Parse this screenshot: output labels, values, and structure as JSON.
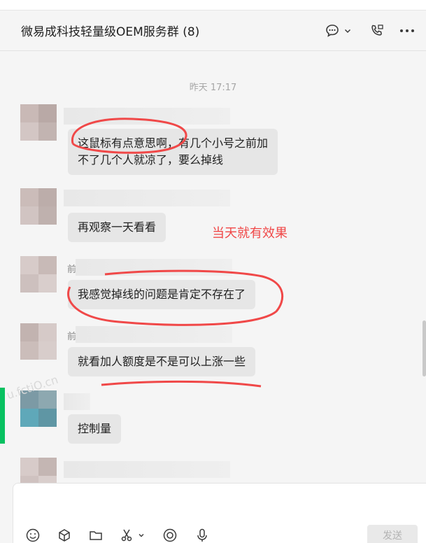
{
  "header": {
    "title": "微易成科技轻量级OEM服务群 (8)"
  },
  "chat": {
    "timestamp": "昨天 17:17",
    "nick_fragment": "前",
    "watermark": "u.fctiO.cn",
    "messages": [
      {
        "text_line1": "这鼠标有点意思啊，有几个小号之前加",
        "text_line2": "不了几个人就凉了，要么掉线"
      },
      {
        "text": "再观察一天看看"
      },
      {
        "text": "我感觉掉线的问题是肯定不存在了"
      },
      {
        "text": "就看加人额度是不是可以上涨一些"
      },
      {
        "text": "控制量"
      }
    ],
    "annotation": "当天就有效果"
  },
  "input": {
    "send_label": "发送"
  },
  "colors": {
    "accent_green": "#07c160",
    "annotation_red": "#f04848",
    "bubble_gray": "#e6e6e6"
  },
  "icons": [
    "chat-bubble-icon",
    "chevron-down-icon",
    "phone-icon",
    "more-icon",
    "emoji-icon",
    "box-icon",
    "folder-icon",
    "scissors-icon",
    "chevron-down-icon",
    "circle-icon",
    "microphone-icon"
  ]
}
